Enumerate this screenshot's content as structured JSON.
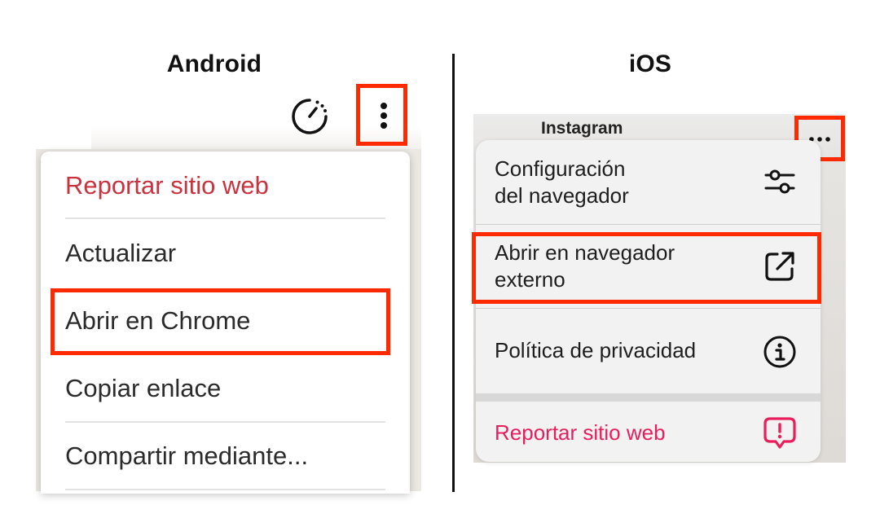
{
  "android": {
    "title": "Android",
    "menu": [
      {
        "label": "Reportar sitio web"
      },
      {
        "label": "Actualizar"
      },
      {
        "label": "Abrir en Chrome"
      },
      {
        "label": "Copiar enlace"
      },
      {
        "label": "Compartir mediante..."
      }
    ],
    "icons": {
      "speed": "speedometer-icon",
      "more": "more-vertical-icon"
    }
  },
  "ios": {
    "title": "iOS",
    "header_text": "Instagram",
    "menu": [
      {
        "line1": "Configuración",
        "line2": "del navegador",
        "icon": "sliders-icon"
      },
      {
        "line1": "Abrir en navegador",
        "line2": "externo",
        "icon": "external-link-icon"
      },
      {
        "label": "Política de privacidad",
        "icon": "info-icon"
      },
      {
        "label": "Reportar sitio web",
        "icon": "report-icon"
      }
    ],
    "more_icon": "more-horizontal-icon"
  },
  "colors": {
    "highlight": "#ff2a00",
    "android_red": "#c9323f",
    "ios_red": "#e81d5c"
  }
}
